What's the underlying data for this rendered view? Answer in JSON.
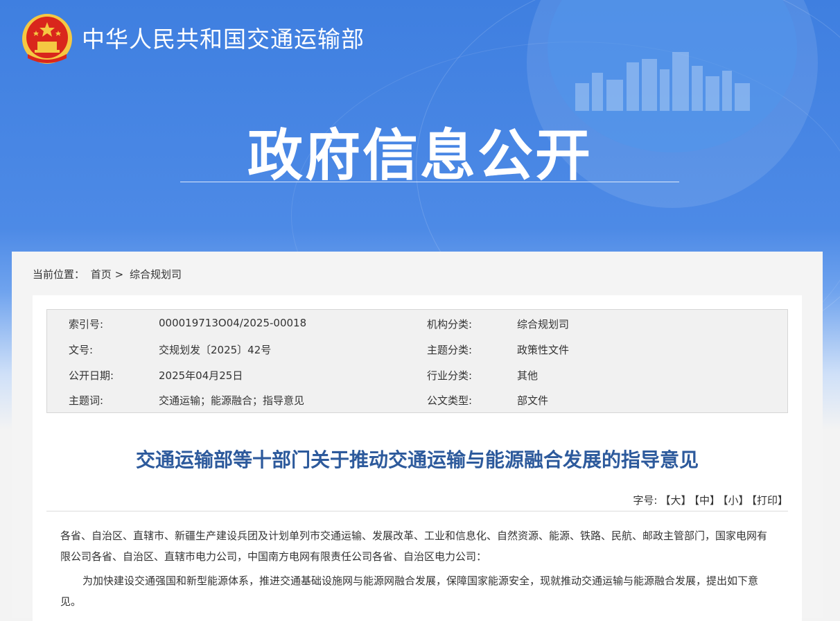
{
  "header": {
    "site_name": "中华人民共和国交通运输部",
    "section_title": "政府信息公开"
  },
  "breadcrumb": {
    "label": "当前位置：",
    "home": "首页",
    "sep": ">",
    "current": "综合规划司"
  },
  "info": {
    "index_label": "索引号:",
    "index_value": "000019713O04/2025-00018",
    "org_label": "机构分类:",
    "org_value": "综合规划司",
    "doc_label": "文号:",
    "doc_value": "交规划发〔2025〕42号",
    "topic_label": "主题分类:",
    "topic_value": "政策性文件",
    "date_label": "公开日期:",
    "date_value": "2025年04月25日",
    "industry_label": "行业分类:",
    "industry_value": "其他",
    "keywords_label": "主题词:",
    "keywords_value": "交通运输；能源融合；指导意见",
    "type_label": "公文类型:",
    "type_value": "部文件"
  },
  "article": {
    "title": "交通运输部等十部门关于推动交通运输与能源融合发展的指导意见",
    "fontsize_label": "字号:",
    "font_large": "【大】",
    "font_medium": "【中】",
    "font_small": "【小】",
    "print": "【打印】",
    "para1": "各省、自治区、直辖市、新疆生产建设兵团及计划单列市交通运输、发展改革、工业和信息化、自然资源、能源、铁路、民航、邮政主管部门，国家电网有限公司各省、自治区、直辖市电力公司，中国南方电网有限责任公司各省、自治区电力公司：",
    "para2": "为加快建设交通强国和新型能源体系，推进交通基础设施网与能源网融合发展，保障国家能源安全，现就推动交通运输与能源融合发展，提出如下意见。"
  },
  "colors": {
    "banner_blue": "#4d8ae6",
    "title_blue": "#2d5a9c",
    "emblem_red": "#d9261c",
    "emblem_gold": "#f5c842"
  }
}
